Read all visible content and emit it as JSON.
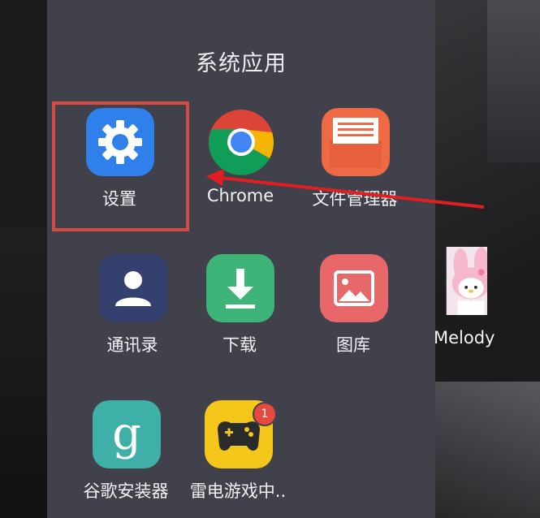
{
  "folder": {
    "title": "系统应用",
    "apps": [
      {
        "label": "设置",
        "icon": "settings-gear-icon",
        "color": "#2f80ea"
      },
      {
        "label": "Chrome",
        "icon": "chrome-icon",
        "color": "#ffffff"
      },
      {
        "label": "文件管理器",
        "icon": "file-manager-icon",
        "color": "#ee6a45"
      },
      {
        "label": "通讯录",
        "icon": "contacts-icon",
        "color": "#34416e"
      },
      {
        "label": "下载",
        "icon": "download-icon",
        "color": "#3fb479"
      },
      {
        "label": "图库",
        "icon": "gallery-icon",
        "color": "#e8686a"
      },
      {
        "label": "谷歌安装器",
        "icon": "google-installer-icon",
        "color": "#3fb0a8"
      },
      {
        "label": "雷电游戏中..",
        "icon": "gamepad-icon",
        "color": "#f5c71a",
        "badge": "1"
      }
    ]
  },
  "desktop": {
    "melody_label": "Melody",
    "melody_icon": "my-melody-icon"
  },
  "annotation": {
    "highlight_color": "#d64a44",
    "arrow_color": "#e02020"
  }
}
